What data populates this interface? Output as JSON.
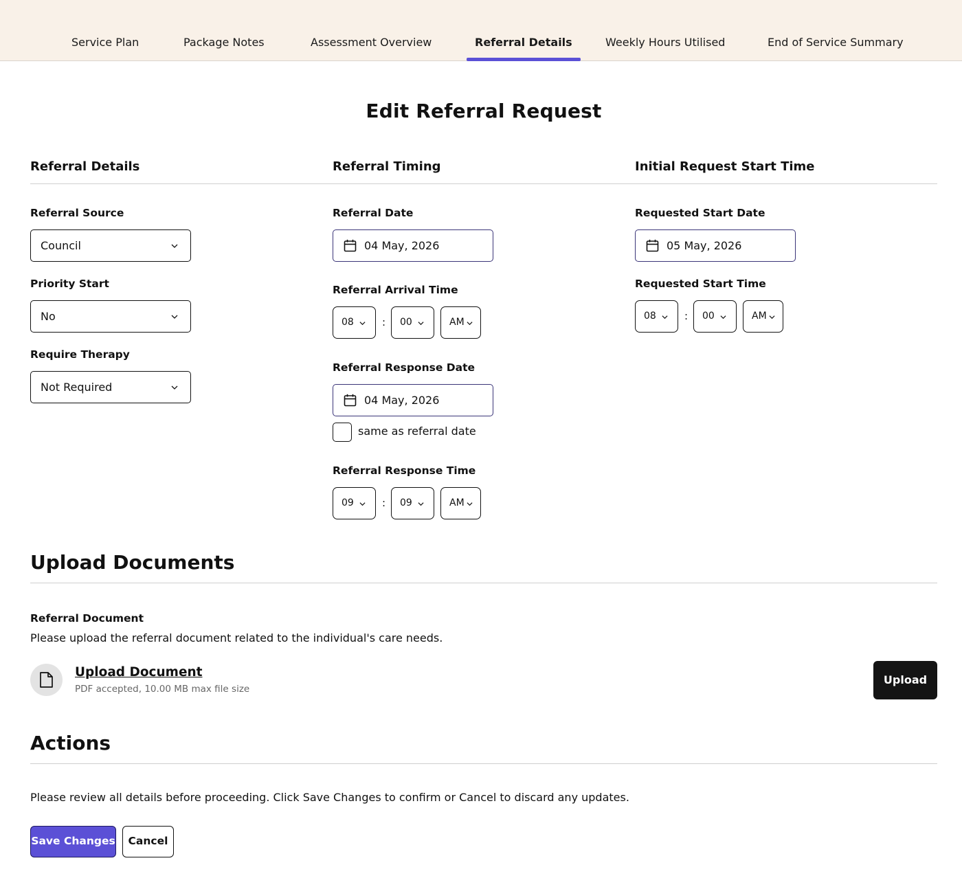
{
  "tabs": [
    {
      "label": "Service Plan",
      "active": false
    },
    {
      "label": "Package Notes",
      "active": false
    },
    {
      "label": "Assessment Overview",
      "active": false
    },
    {
      "label": "Referral Details",
      "active": true
    },
    {
      "label": "Weekly Hours Utilised",
      "active": false
    },
    {
      "label": "End of Service Summary",
      "active": false
    }
  ],
  "page_title": "Edit Referral Request",
  "referral_details": {
    "title": "Referral Details",
    "referral_source": {
      "label": "Referral Source",
      "value": "Council"
    },
    "priority_start": {
      "label": "Priority Start",
      "value": "No"
    },
    "require_therapy": {
      "label": "Require Therapy",
      "value": "Not Required"
    }
  },
  "referral_timing": {
    "title": "Referral Timing",
    "referral_date": {
      "label": "Referral Date",
      "value": "04 May, 2026"
    },
    "arrival_time": {
      "label": "Referral Arrival Time",
      "hour": "08",
      "minute": "00",
      "period": "AM"
    },
    "response_date": {
      "label": "Referral Response Date",
      "value": "04 May, 2026"
    },
    "same_as_referral": {
      "label": "same as referral date",
      "checked": false
    },
    "response_time": {
      "label": "Referral Response Time",
      "hour": "09",
      "minute": "09",
      "period": "AM"
    }
  },
  "initial_request": {
    "title": "Initial Request Start Time",
    "start_date": {
      "label": "Requested Start Date",
      "value": "05 May, 2026"
    },
    "start_time": {
      "label": "Requested Start Time",
      "hour": "08",
      "minute": "00",
      "period": "AM"
    }
  },
  "upload": {
    "title": "Upload Documents",
    "doc_label": "Referral Document",
    "doc_desc": "Please upload the referral document related to the individual's care needs.",
    "link_label": "Upload Document",
    "hint": "PDF accepted, 10.00 MB max file size",
    "button_label": "Upload"
  },
  "actions": {
    "title": "Actions",
    "desc": "Please review all details before proceeding. Click Save Changes to confirm or Cancel to discard any updates.",
    "save_label": "Save Changes",
    "cancel_label": "Cancel"
  },
  "colors": {
    "accent": "#5b50d6",
    "tabbar_bg": "#f9f1e8",
    "dark_button": "#141414"
  },
  "icons": [
    "chevron-down-icon",
    "calendar-icon",
    "document-icon"
  ]
}
